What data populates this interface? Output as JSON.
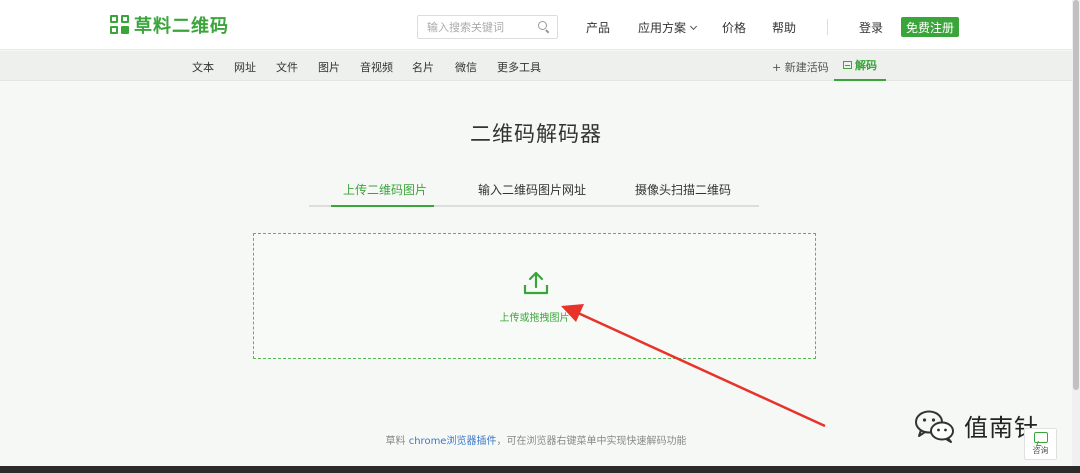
{
  "header": {
    "logo_text": "草料二维码",
    "search_placeholder": "输入搜索关键词",
    "nav": [
      "产品",
      "应用方案",
      "价格",
      "帮助"
    ],
    "login": "登录",
    "register": "免费注册"
  },
  "subnav": {
    "items": [
      "文本",
      "网址",
      "文件",
      "图片",
      "音视频",
      "名片",
      "微信",
      "更多工具"
    ],
    "new_live": "+ 新建活码",
    "decode": "解码"
  },
  "main": {
    "title": "二维码解码器",
    "tabs": [
      {
        "label": "上传二维码图片",
        "active": true
      },
      {
        "label": "输入二维码图片网址",
        "active": false
      },
      {
        "label": "摄像头扫描二维码",
        "active": false
      }
    ],
    "upload_text": "上传或拖拽图片"
  },
  "footer": {
    "prefix": "草料 ",
    "link": "chrome浏览器插件",
    "suffix": "，可在浏览器右键菜单中实现快速解码功能"
  },
  "watermark": {
    "text": "值南针"
  },
  "consult": {
    "label": "咨询"
  },
  "colors": {
    "brand_green": "#3aa53a",
    "arrow_red": "#e8332a"
  }
}
